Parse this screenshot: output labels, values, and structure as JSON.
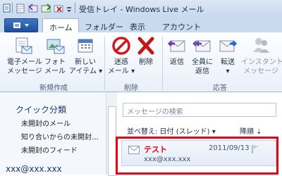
{
  "window": {
    "title": "受信トレイ - Windows Live メール"
  },
  "tabs": [
    {
      "label": "ホーム",
      "active": true
    },
    {
      "label": "フォルダー"
    },
    {
      "label": "表示"
    },
    {
      "label": "アカウント"
    }
  ],
  "ribbon": {
    "new_email": [
      "電子メール",
      "メッセージ"
    ],
    "photo_email": [
      "フォト",
      "メール"
    ],
    "new_items": [
      "新しい",
      "アイテム ▾"
    ],
    "junk": [
      "迷惑",
      "メール ▾"
    ],
    "delete": "削除",
    "reply": "返信",
    "reply_all": [
      "全員に",
      "返信"
    ],
    "forward": [
      "転送",
      "▾"
    ],
    "im": [
      "インスタント",
      "メッセージ"
    ],
    "groups": {
      "new": "新規作成",
      "delete": "削除",
      "respond": "応答"
    }
  },
  "sidebar": {
    "quick_views_title": "クイック分類",
    "items": [
      "未開封のメール",
      "知り合いからの未開封…",
      "未開封のフィード"
    ],
    "account": "xxx@xxx.xxx"
  },
  "message_list": {
    "search_placeholder": "メッセージの検索",
    "sort_label": "並べ替え: 日付 (スレッド) ▾",
    "order_label": "降順 ⇣",
    "messages": [
      {
        "subject": "テスト",
        "from": "xxx@xxx.xxx",
        "date": "2011/09/13"
      }
    ]
  },
  "colors": {
    "highlight": "#e60012",
    "accent": "#1d4e9c"
  }
}
